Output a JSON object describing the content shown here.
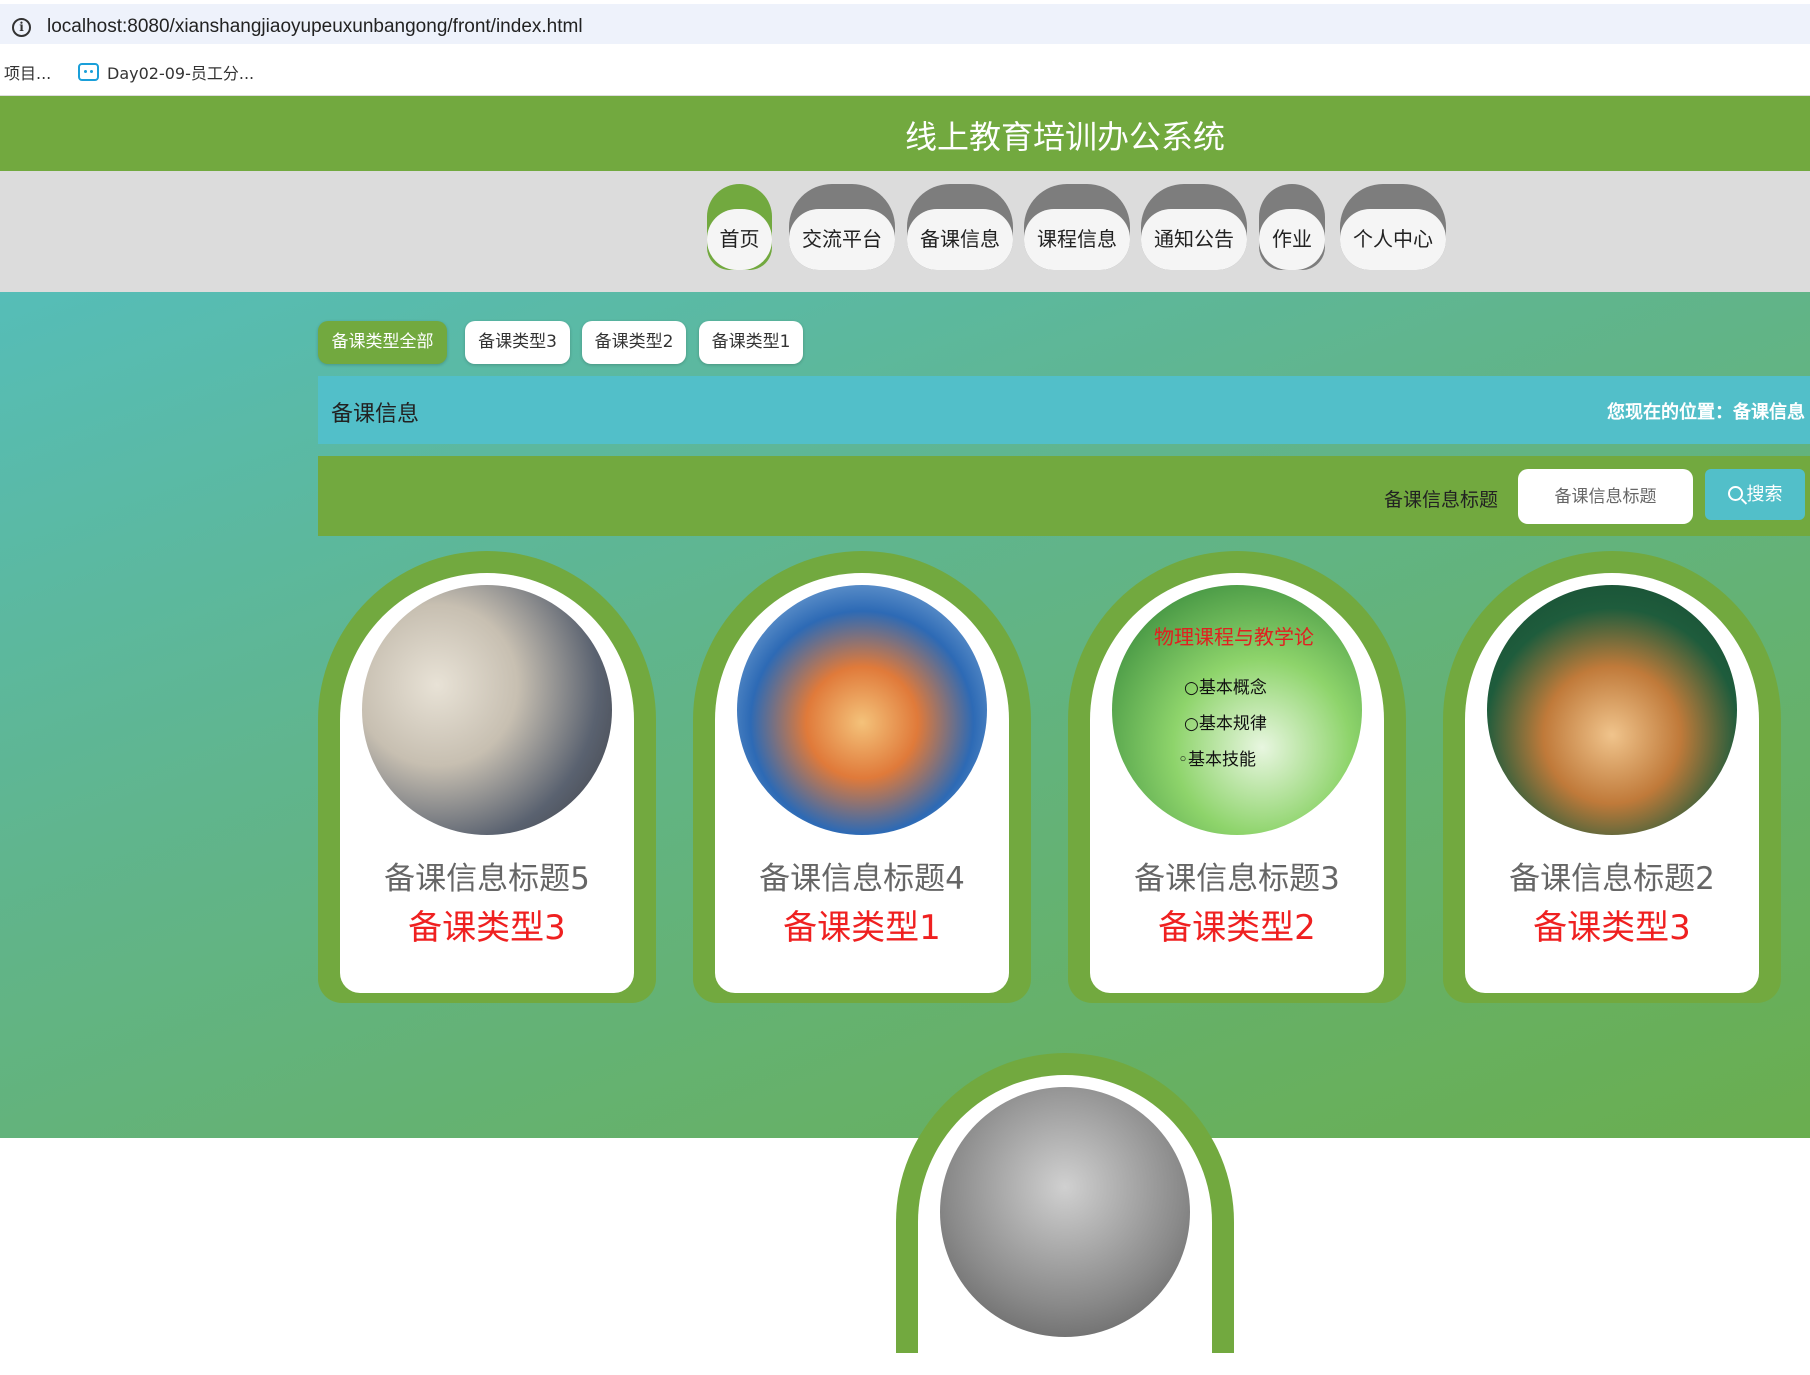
{
  "browser": {
    "url": "localhost:8080/xianshangjiaoyupeuxunbangong/front/index.html",
    "bookmarks": [
      "项目...",
      "Day02-09-员工分..."
    ]
  },
  "header": {
    "title": "线上教育培训办公系统"
  },
  "nav": {
    "items": [
      {
        "label": "首页",
        "active": true
      },
      {
        "label": "交流平台",
        "active": false
      },
      {
        "label": "备课信息",
        "active": false
      },
      {
        "label": "课程信息",
        "active": false
      },
      {
        "label": "通知公告",
        "active": false
      },
      {
        "label": "作业",
        "active": false
      },
      {
        "label": "个人中心",
        "active": false
      }
    ]
  },
  "filters": {
    "types": [
      {
        "label": "备课类型全部",
        "active": true
      },
      {
        "label": "备课类型3",
        "active": false
      },
      {
        "label": "备课类型2",
        "active": false
      },
      {
        "label": "备课类型1",
        "active": false
      }
    ]
  },
  "section": {
    "title": "备课信息",
    "breadcrumb": "您现在的位置：备课信息"
  },
  "search": {
    "label": "备课信息标题",
    "placeholder": "备课信息标题",
    "button": "搜索"
  },
  "cards": [
    {
      "title": "备课信息标题5",
      "type": "备课类型3"
    },
    {
      "title": "备课信息标题4",
      "type": "备课类型1"
    },
    {
      "title": "备课信息标题3",
      "type": "备课类型2",
      "image_text": {
        "title": "物理课程与教学论",
        "lines": [
          "○基本概念",
          "○基本规律",
          "◦基本技能"
        ]
      }
    },
    {
      "title": "备课信息标题2",
      "type": "备课类型3"
    }
  ],
  "colors": {
    "primary": "#72a93f",
    "accent": "#52bfc9",
    "type_text": "#ef2020"
  }
}
